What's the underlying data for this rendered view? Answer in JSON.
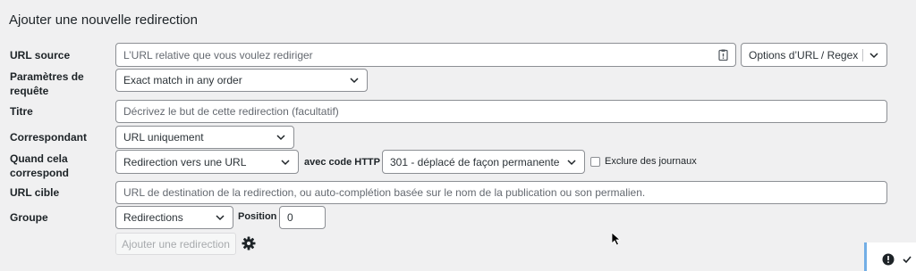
{
  "heading": "Ajouter une nouvelle redirection",
  "labels": {
    "source_url": "URL source",
    "query_params_line1": "Paramètres de",
    "query_params_line2": "requête",
    "title": "Titre",
    "match": "Correspondant",
    "when_matched_line1": "Quand cela",
    "when_matched_line2": "correspond",
    "target_url": "URL cible",
    "group": "Groupe"
  },
  "source_url": {
    "placeholder": "L’URL relative que vous voulez rediriger"
  },
  "url_options": {
    "label": "Options d’URL / Regex"
  },
  "query_params": {
    "value": "Exact match in any order"
  },
  "title": {
    "placeholder": "Décrivez le but de cette redirection (facultatif)"
  },
  "match": {
    "value": "URL uniquement"
  },
  "action": {
    "value": "Redirection vers une URL"
  },
  "http_code": {
    "label": "avec code HTTP",
    "value": "301 - déplacé de façon permanente"
  },
  "exclude_logs": {
    "label": "Exclure des journaux",
    "checked": false
  },
  "target_url": {
    "placeholder": "URL de destination de la redirection, ou auto-complétion basée sur le nom de la publication ou son permalien."
  },
  "group": {
    "value": "Redirections"
  },
  "position": {
    "label": "Position",
    "value": "0"
  },
  "add_button": {
    "label": "Ajouter une redirection"
  },
  "icons": [
    "clipboard-icon",
    "chevron-down-icon",
    "gear-icon",
    "cursor-icon",
    "alert-icon",
    "check-icon"
  ],
  "colors": {
    "background": "#f0f0f1",
    "border": "#8c8f94",
    "notice_accent": "#72aee6"
  }
}
